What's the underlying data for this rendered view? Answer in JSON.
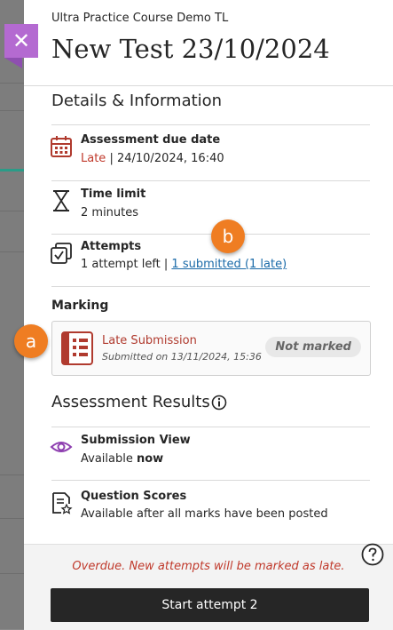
{
  "header": {
    "close_symbol": "✕",
    "course_name": "Ultra Practice Course Demo TL",
    "title": "New Test 23/10/2024"
  },
  "details": {
    "section_title": "Details & Information",
    "due": {
      "label": "Assessment due date",
      "status": "Late",
      "separator": " | ",
      "date": "24/10/2024, 16:40",
      "icon": "calendar-icon"
    },
    "time_limit": {
      "label": "Time limit",
      "value": "2 minutes",
      "icon": "hourglass-icon"
    },
    "attempts": {
      "label": "Attempts",
      "left_text": "1 attempt left",
      "separator": " | ",
      "link_text": "1 submitted (1 late)",
      "icon": "attempts-icon"
    }
  },
  "marking": {
    "label": "Marking",
    "submission_title": "Late Submission",
    "submission_meta": "Submitted on 13/11/2024, 15:36",
    "badge": "Not marked"
  },
  "results": {
    "section_title": "Assessment Results",
    "submission_view": {
      "label": "Submission View",
      "value_prefix": "Available ",
      "value_bold": "now",
      "icon": "eye-icon"
    },
    "question_scores": {
      "label": "Question Scores",
      "value": "Available after all marks have been posted",
      "icon": "score-document-icon"
    }
  },
  "footer": {
    "overdue_text": "Overdue. New attempts will be marked as late.",
    "start_button": "Start attempt 2"
  },
  "callouts": {
    "a": "a",
    "b": "b"
  },
  "colors": {
    "accent_purple": "#b46ad1",
    "late_red": "#c0392b",
    "link_blue": "#1a6aa8",
    "callout_orange": "#ef7d22",
    "button_dark": "#262626"
  }
}
